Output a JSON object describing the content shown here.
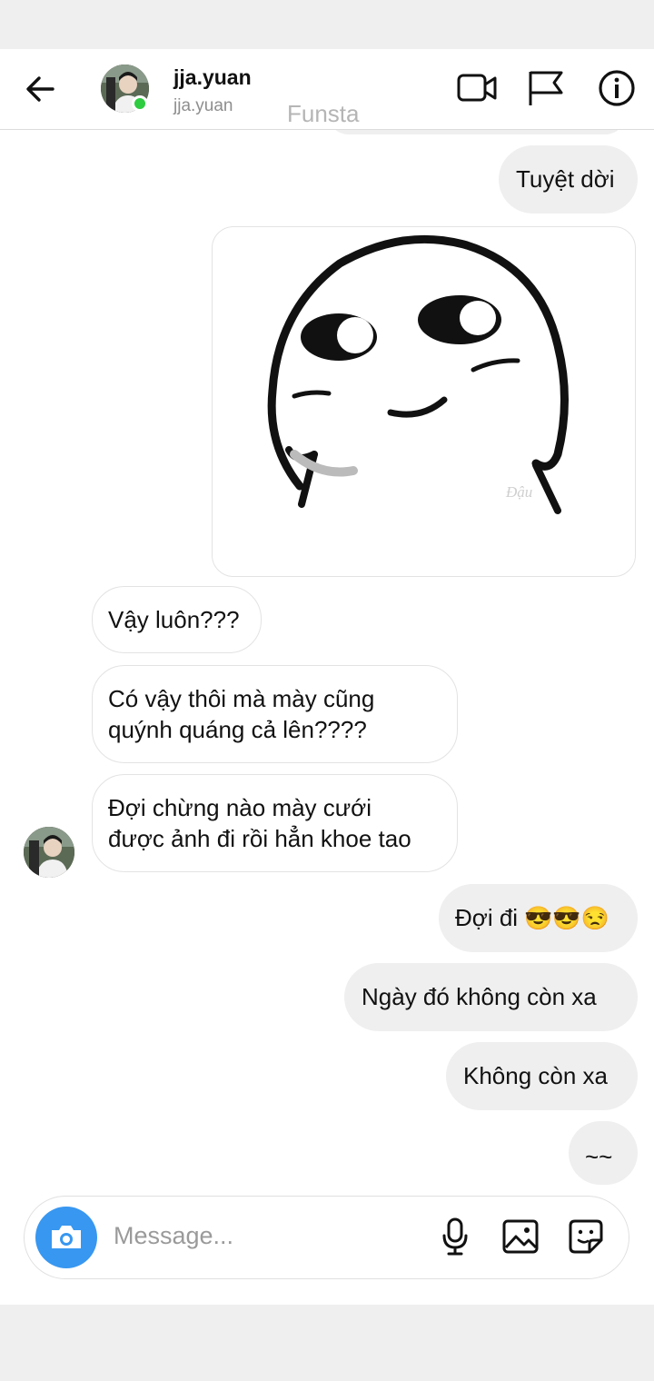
{
  "header": {
    "username": "jja.yuan",
    "handle": "jja.yuan",
    "watermark": "Funsta",
    "icons": [
      "back-arrow-icon",
      "video-call-icon",
      "flag-icon",
      "info-icon"
    ]
  },
  "sticker": {
    "signature": "Đậu"
  },
  "messages": [
    {
      "side": "out",
      "text": "Tuyệt dời"
    },
    {
      "side": "in",
      "text": "Vậy luôn???"
    },
    {
      "side": "in",
      "line1": "Có vậy thôi mà mày cũng",
      "line2": "quýnh quáng cả lên????"
    },
    {
      "side": "in",
      "line1": "Đợi chừng nào mày cưới",
      "line2": "được ảnh đi rồi hẳn khoe tao"
    },
    {
      "side": "out",
      "text": "Đợi đi",
      "emoji": "😎😎😒"
    },
    {
      "side": "out",
      "text": "Ngày đó không còn xa"
    },
    {
      "side": "out",
      "text": "Không còn xa"
    },
    {
      "side": "out",
      "text": "~~"
    }
  ],
  "composer": {
    "placeholder": "Message...",
    "icons": [
      "camera-icon",
      "microphone-icon",
      "gallery-icon",
      "sticker-icon"
    ],
    "camera_color": "#3897f0"
  },
  "colors": {
    "online": "#2ecc40",
    "outgoing_bubble": "#efefef"
  }
}
